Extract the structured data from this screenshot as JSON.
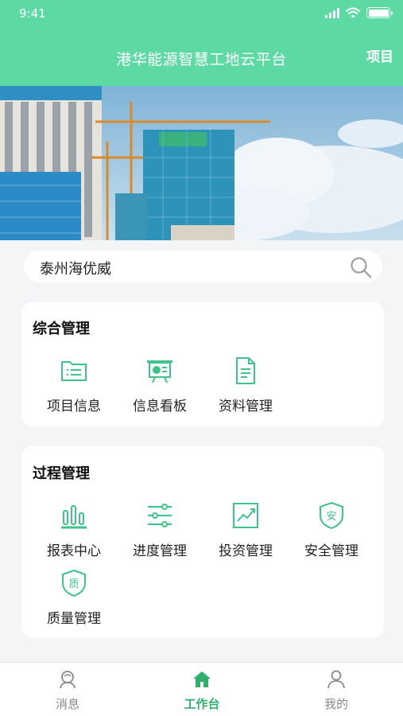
{
  "status_bar": {
    "time": "9:41"
  },
  "header": {
    "title": "港华能源智慧工地云平台",
    "project_link": "项目"
  },
  "search": {
    "value": "泰州海优威"
  },
  "sections": [
    {
      "title": "综合管理",
      "items": [
        {
          "label": "项目信息",
          "icon": "folder-list-icon"
        },
        {
          "label": "信息看板",
          "icon": "presentation-board-icon"
        },
        {
          "label": "资料管理",
          "icon": "document-icon"
        }
      ]
    },
    {
      "title": "过程管理",
      "items": [
        {
          "label": "报表中心",
          "icon": "bar-chart-icon"
        },
        {
          "label": "进度管理",
          "icon": "sliders-icon"
        },
        {
          "label": "投资管理",
          "icon": "trend-chart-icon"
        },
        {
          "label": "安全管理",
          "icon": "safety-shield-icon",
          "glyph": "安"
        },
        {
          "label": "质量管理",
          "icon": "quality-shield-icon",
          "glyph": "质"
        }
      ]
    }
  ],
  "tabs": [
    {
      "label": "消息",
      "icon": "message-icon",
      "active": false
    },
    {
      "label": "工作台",
      "icon": "home-icon",
      "active": true
    },
    {
      "label": "我的",
      "icon": "user-icon",
      "active": false
    }
  ],
  "colors": {
    "header": "#5dd9a4",
    "accent": "#3cc48a",
    "active_tab": "#2fb06d",
    "background": "#f4f5f7"
  }
}
